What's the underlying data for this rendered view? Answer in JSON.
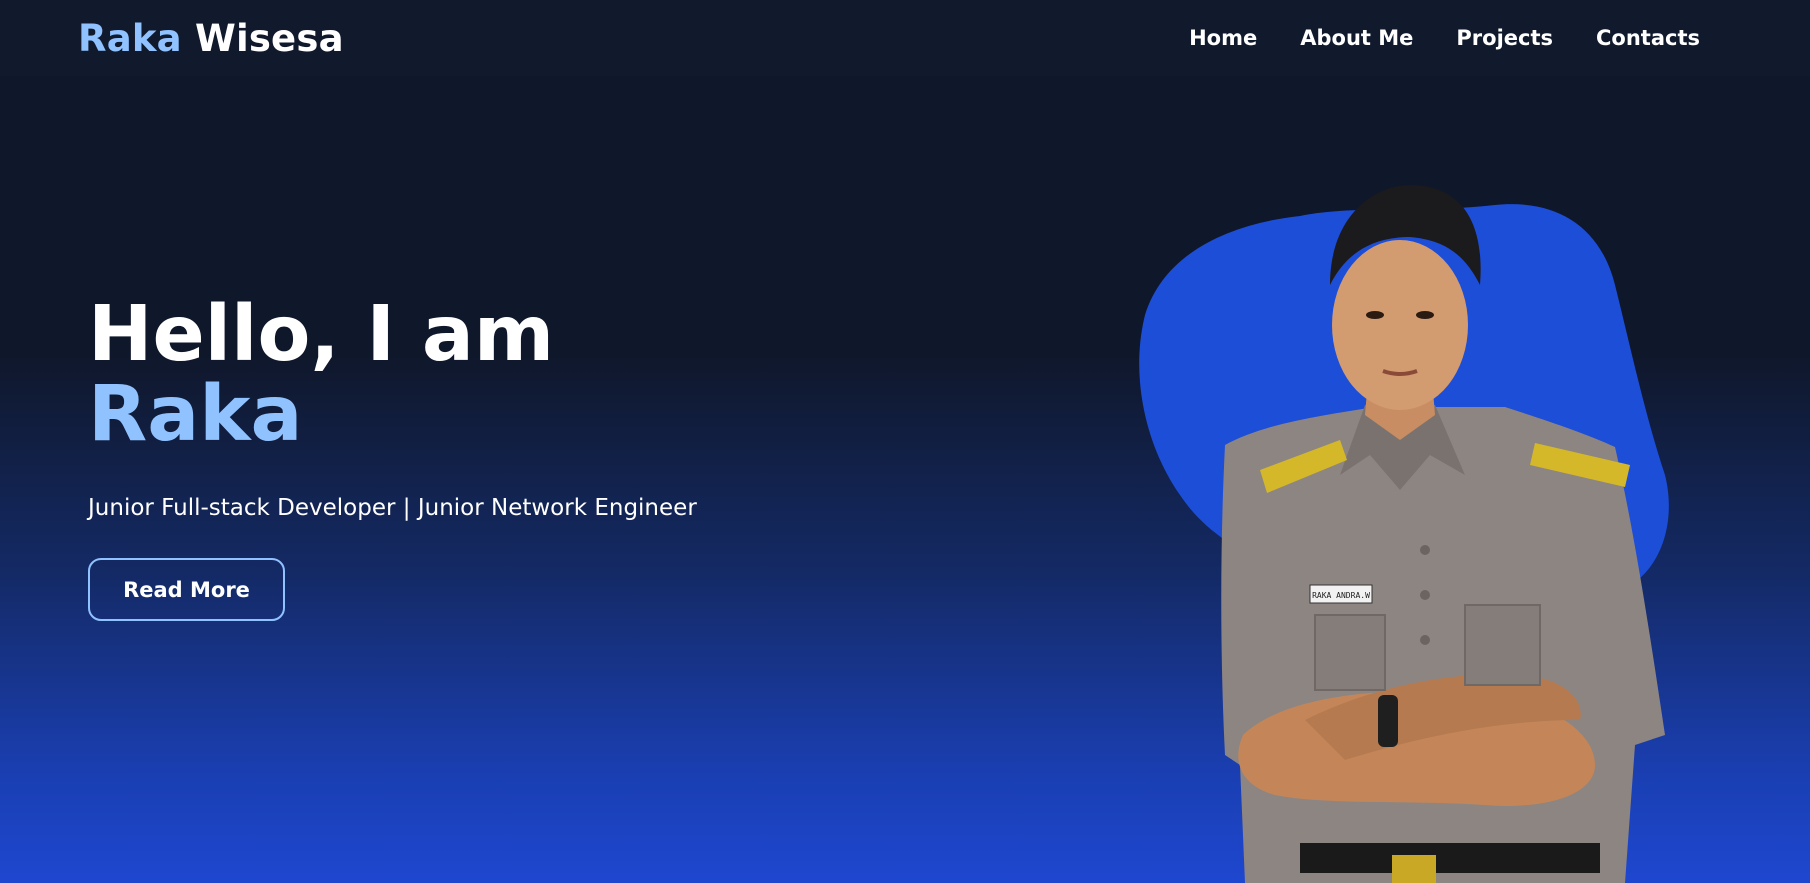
{
  "navbar": {
    "brand_first": "Raka",
    "brand_last": "Wisesa",
    "links": [
      {
        "label": "Home"
      },
      {
        "label": "About Me"
      },
      {
        "label": "Projects"
      },
      {
        "label": "Contacts"
      }
    ]
  },
  "hero": {
    "greeting": "Hello, I am",
    "name": "Raka",
    "tagline": "Junior Full-stack Developer | Junior Network Engineer",
    "button_label": "Read More"
  },
  "portrait": {
    "name_tag": "RAKA ANDRA.W"
  },
  "colors": {
    "accent": "#90c2ff",
    "blob": "#1d4ed8",
    "navbar_bg": "#111a2d",
    "bg_top": "#0f172a",
    "bg_bottom": "#1e47d0"
  }
}
